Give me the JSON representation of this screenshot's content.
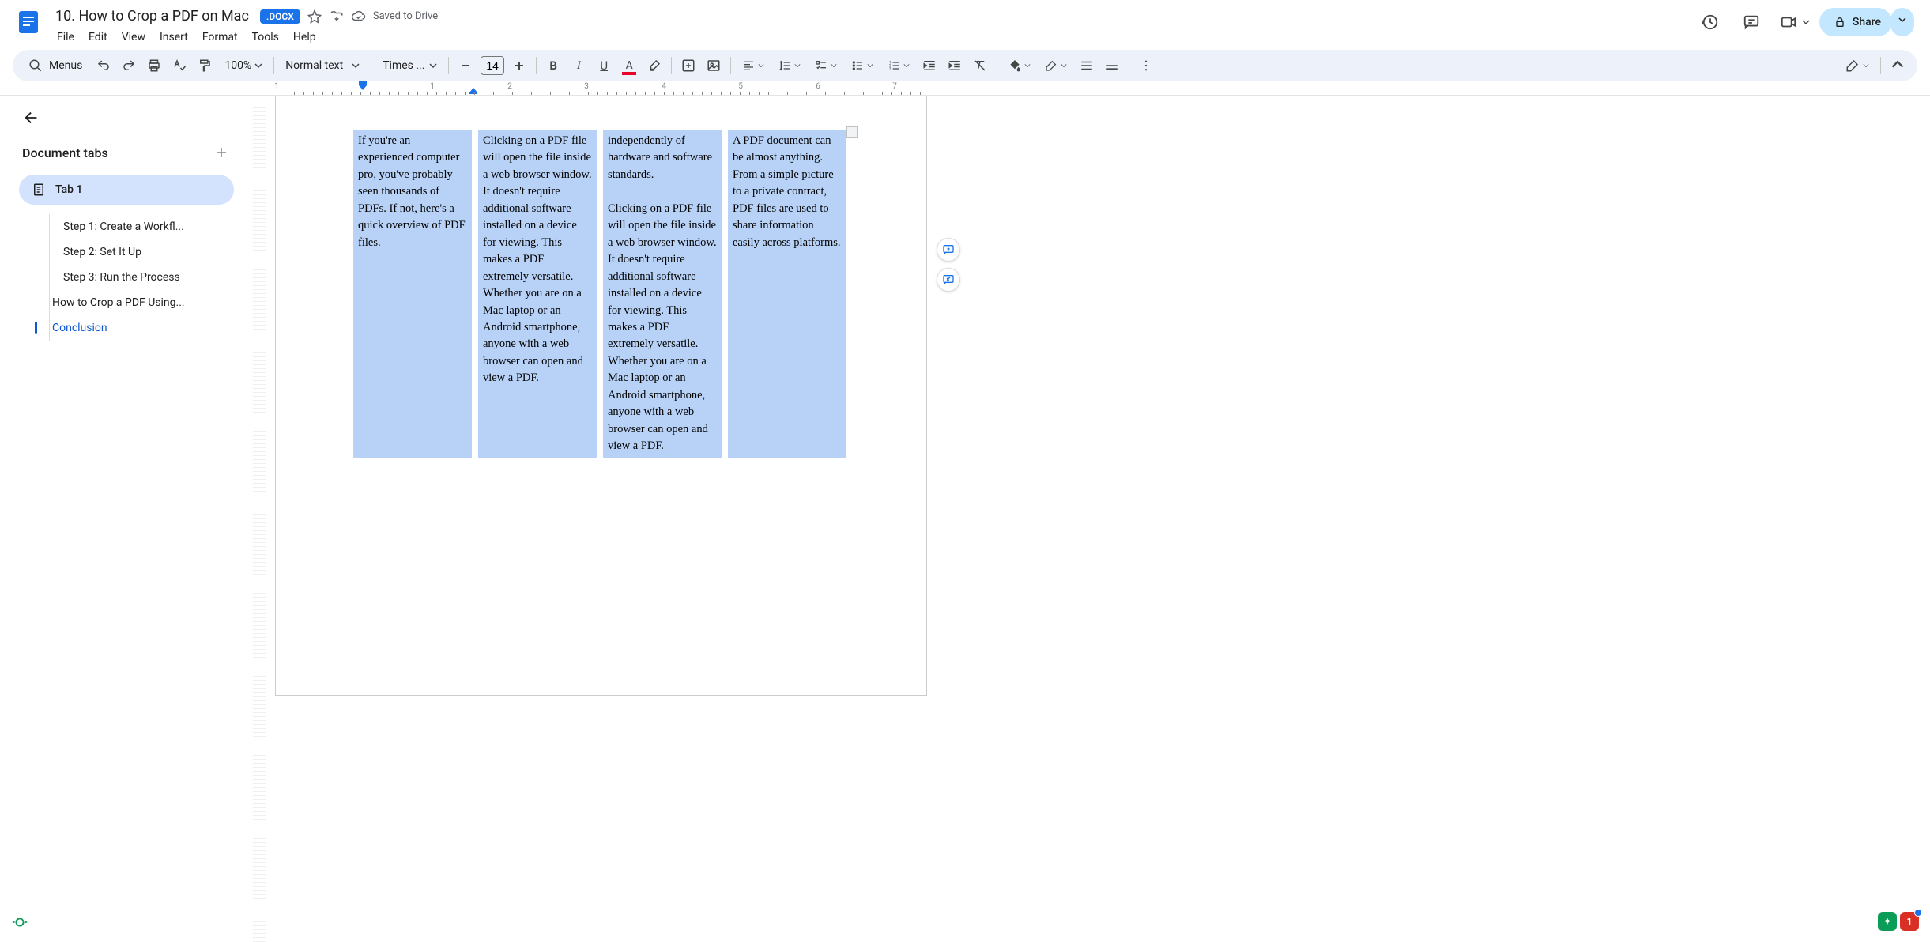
{
  "header": {
    "doc_title": "10. How to Crop a PDF on Mac",
    "badge": ".DOCX",
    "saved": "Saved to Drive",
    "menus": [
      "File",
      "Edit",
      "View",
      "Insert",
      "Format",
      "Tools",
      "Help"
    ],
    "share": "Share"
  },
  "toolbar": {
    "search_label": "Menus",
    "zoom": "100%",
    "style": "Normal text",
    "font": "Times ...",
    "font_size": "14"
  },
  "ruler_numbers": [
    "1",
    "1",
    "2",
    "3",
    "4",
    "5",
    "6",
    "7"
  ],
  "sidebar": {
    "title": "Document tabs",
    "tab1": "Tab 1",
    "items": [
      {
        "label": "Step 1: Create a Workfl...",
        "lvl": 2
      },
      {
        "label": "Step 2: Set It Up",
        "lvl": 2
      },
      {
        "label": "Step 3: Run the Process",
        "lvl": 2
      },
      {
        "label": "How to Crop a PDF Using...",
        "lvl": 1
      },
      {
        "label": "Conclusion",
        "lvl": 1,
        "active": true
      }
    ]
  },
  "columns": [
    "If you're an experienced computer pro, you've probably seen thousands of PDFs. If not, here's a quick overview of PDF files.",
    "Clicking on a PDF file will open the file inside a web browser window. It doesn't require additional software installed on a device for viewing. This makes a PDF extremely versatile. Whether you are on a Mac laptop or an Android smartphone, anyone with a web browser can open and view a PDF.",
    "independently of hardware and software standards.\n\nClicking on a PDF file will open the file inside a web browser window. It doesn't require additional software installed on a device for viewing. This makes a PDF extremely versatile. Whether you are on a Mac laptop or an Android smartphone, anyone with a web browser can open and view a PDF.",
    "A PDF document can be almost anything. From a simple picture to a private contract, PDF files are used to share information easily across platforms."
  ],
  "badge_count": "1"
}
